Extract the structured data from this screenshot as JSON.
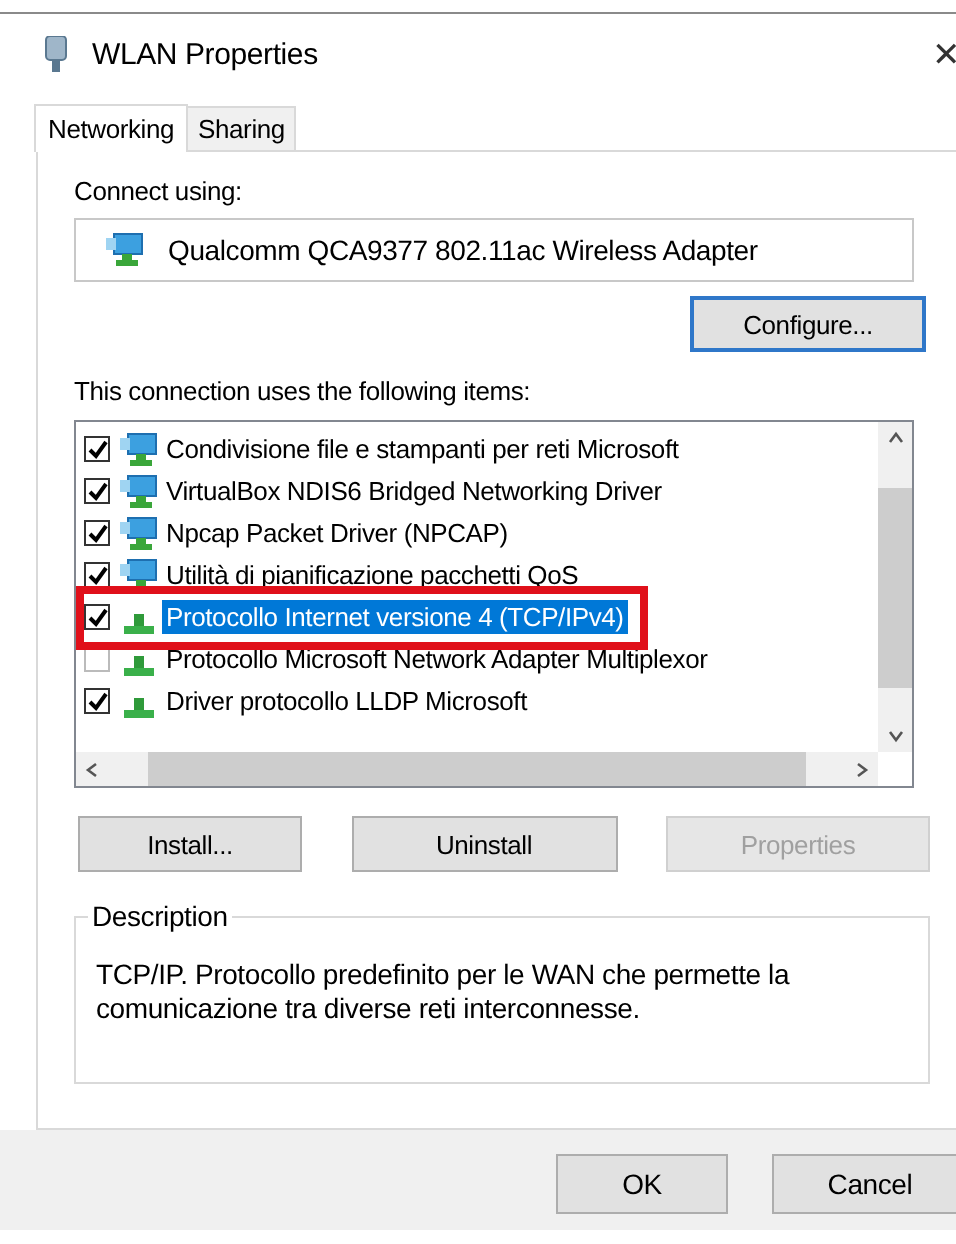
{
  "window": {
    "title": "WLAN Properties",
    "close": "✕"
  },
  "tabs": [
    {
      "label": "Networking",
      "selected": true
    },
    {
      "label": "Sharing",
      "selected": false
    }
  ],
  "connect_using": {
    "label": "Connect using:",
    "adapter": "Qualcomm QCA9377 802.11ac Wireless Adapter",
    "configure_button": "Configure..."
  },
  "items_label": "This connection uses the following items:",
  "items": [
    {
      "kind": "service",
      "label": "Condivisione file e stampanti per reti Microsoft",
      "checked": true,
      "selected": false,
      "highlighted": false
    },
    {
      "kind": "service",
      "label": "VirtualBox NDIS6 Bridged Networking Driver",
      "checked": true,
      "selected": false,
      "highlighted": false
    },
    {
      "kind": "service",
      "label": "Npcap Packet Driver (NPCAP)",
      "checked": true,
      "selected": false,
      "highlighted": false
    },
    {
      "kind": "service",
      "label": "Utilità di pianificazione pacchetti QoS",
      "checked": true,
      "selected": false,
      "highlighted": false
    },
    {
      "kind": "protocol",
      "label": "Protocollo Internet versione 4 (TCP/IPv4)",
      "checked": true,
      "selected": true,
      "highlighted": true
    },
    {
      "kind": "protocol",
      "label": "Protocollo Microsoft Network Adapter Multiplexor",
      "checked": false,
      "selected": false,
      "highlighted": false
    },
    {
      "kind": "protocol",
      "label": "Driver protocollo LLDP Microsoft",
      "checked": true,
      "selected": false,
      "highlighted": false
    }
  ],
  "item_buttons": [
    {
      "label": "Install...",
      "disabled": false
    },
    {
      "label": "Uninstall",
      "disabled": false
    },
    {
      "label": "Properties",
      "disabled": true
    }
  ],
  "description": {
    "title": "Description",
    "text": "TCP/IP. Protocollo predefinito per le WAN che permette la comunicazione tra diverse reti interconnesse."
  },
  "dialog_buttons": [
    "OK",
    "Cancel"
  ]
}
